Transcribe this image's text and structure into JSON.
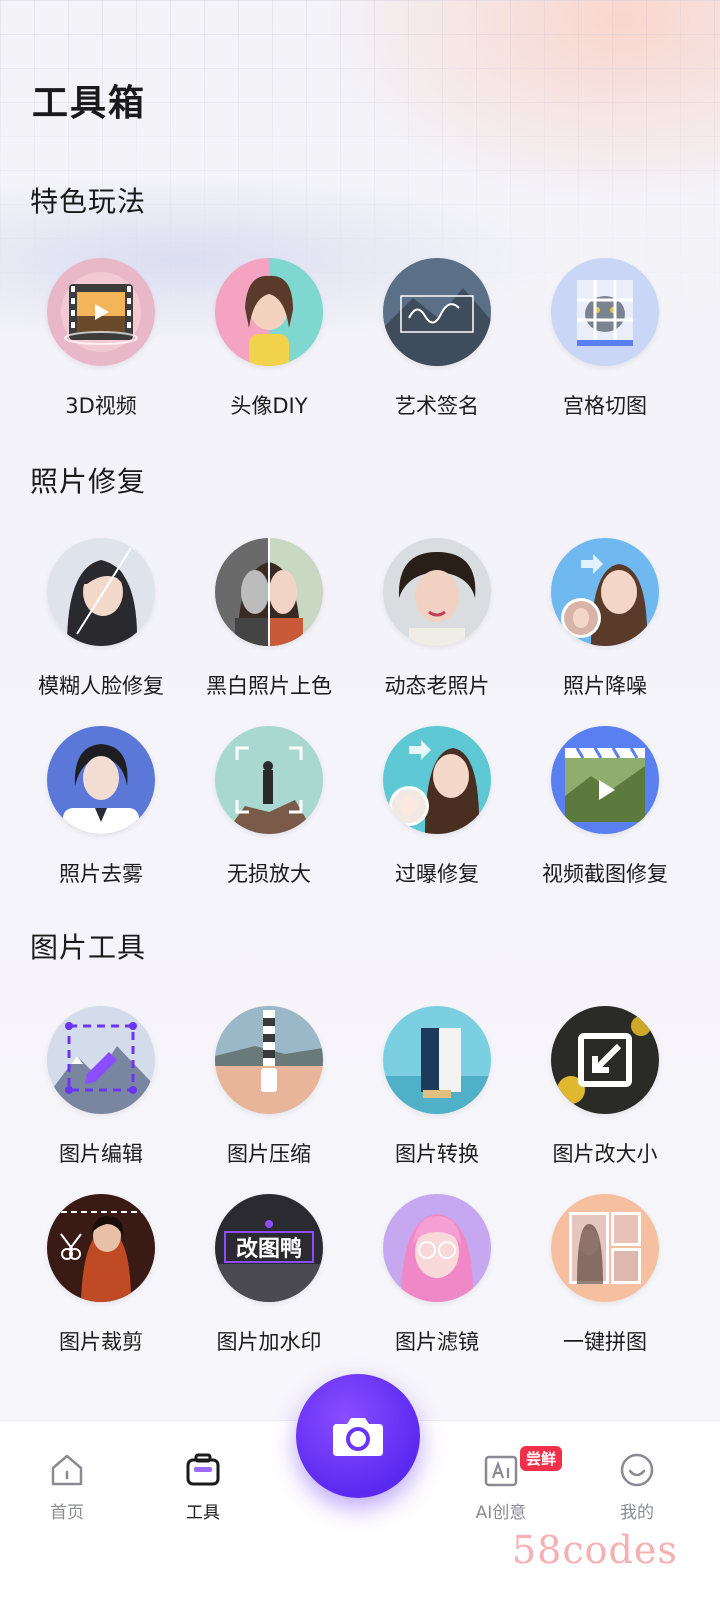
{
  "page": {
    "title": "工具箱"
  },
  "sections": [
    {
      "title": "特色玩法",
      "items": [
        {
          "label": "3D视频",
          "icon": "film-3d-icon"
        },
        {
          "label": "头像DIY",
          "icon": "avatar-diy-icon"
        },
        {
          "label": "艺术签名",
          "icon": "art-signature-icon"
        },
        {
          "label": "宫格切图",
          "icon": "grid-cut-icon"
        }
      ]
    },
    {
      "title": "照片修复",
      "items": [
        {
          "label": "模糊人脸修复",
          "icon": "face-deblur-icon"
        },
        {
          "label": "黑白照片上色",
          "icon": "colorize-icon"
        },
        {
          "label": "动态老照片",
          "icon": "animate-old-photo-icon"
        },
        {
          "label": "照片降噪",
          "icon": "denoise-icon"
        },
        {
          "label": "照片去雾",
          "icon": "dehaze-icon"
        },
        {
          "label": "无损放大",
          "icon": "upscale-icon"
        },
        {
          "label": "过曝修复",
          "icon": "overexposure-fix-icon"
        },
        {
          "label": "视频截图修复",
          "icon": "video-frame-fix-icon"
        }
      ]
    },
    {
      "title": "图片工具",
      "items": [
        {
          "label": "图片编辑",
          "icon": "image-edit-icon"
        },
        {
          "label": "图片压缩",
          "icon": "image-compress-icon"
        },
        {
          "label": "图片转换",
          "icon": "image-convert-icon"
        },
        {
          "label": "图片改大小",
          "icon": "image-resize-icon"
        },
        {
          "label": "图片裁剪",
          "icon": "image-crop-icon"
        },
        {
          "label": "图片加水印",
          "icon": "image-watermark-icon",
          "overlay_text": "改图鸭"
        },
        {
          "label": "图片滤镜",
          "icon": "image-filter-icon"
        },
        {
          "label": "一键拼图",
          "icon": "collage-icon"
        }
      ]
    }
  ],
  "nav": {
    "home": "首页",
    "tools": "工具",
    "ai": "AI创意",
    "ai_badge": "尝鲜",
    "me": "我的"
  },
  "watermark": "58codes",
  "colors": {
    "accent": "#6a35f5",
    "badge": "#f0304a"
  }
}
